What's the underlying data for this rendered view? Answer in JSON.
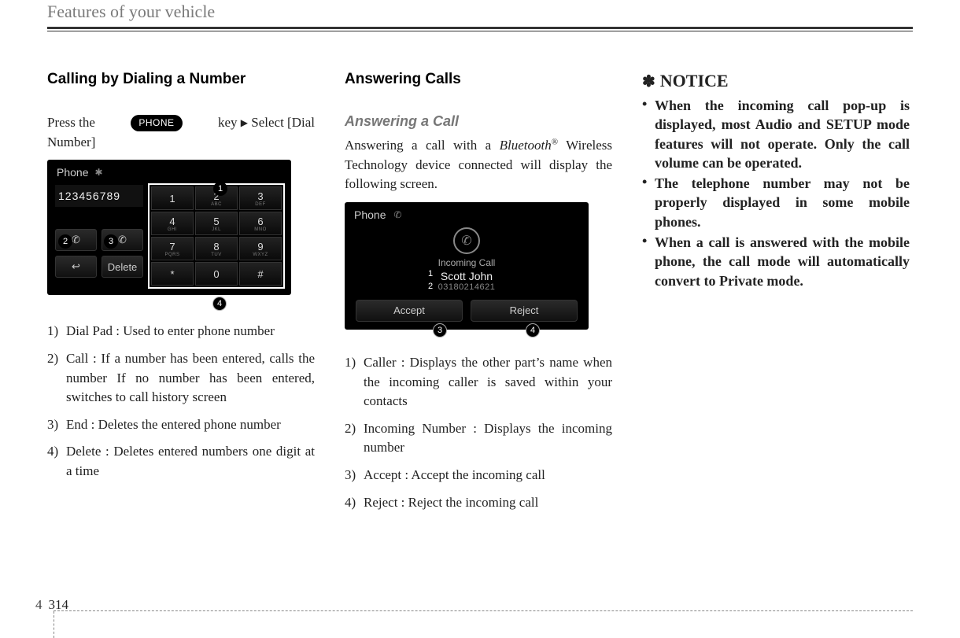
{
  "header": {
    "title": "Features of your vehicle"
  },
  "col1": {
    "heading": "Calling by Dialing a Number",
    "press_a": "Press the",
    "press_b": "key",
    "press_c": "Select [Dial",
    "press_d": "Number]",
    "phone_key_label": "PHONE",
    "shot": {
      "title": "Phone",
      "number": "123456789",
      "delete": "Delete",
      "keys": [
        "1",
        "2",
        "3",
        "4",
        "5",
        "6",
        "7",
        "8",
        "9",
        "*",
        "0",
        "#"
      ],
      "subs": [
        "",
        "ABC",
        "DEF",
        "GHI",
        "JKL",
        "MNO",
        "PQRS",
        "TUV",
        "WXYZ",
        "",
        "",
        ""
      ]
    },
    "markers": [
      "1",
      "2",
      "3",
      "4"
    ],
    "list": [
      "Dial Pad : Used to enter phone number",
      "Call : If a number has been entered, calls the number If no number has been entered, switches to call history screen",
      "End : Deletes the entered phone number",
      "Delete : Deletes entered numbers one digit at a time"
    ]
  },
  "col2": {
    "heading": "Answering Calls",
    "subheading": "Answering a Call",
    "body_a": "Answering a call with a ",
    "body_b": "Bluetooth",
    "body_sup": "®",
    "body_c": " Wireless Technology device connected will display the following screen.",
    "shot": {
      "title": "Phone",
      "label": "Incoming Call",
      "name": "Scott John",
      "number": "03180214621",
      "accept": "Accept",
      "reject": "Reject"
    },
    "markers": [
      "1",
      "2",
      "3",
      "4"
    ],
    "list": [
      "Caller : Displays the other part’s name when the incoming caller is saved within your contacts",
      "Incoming Number : Displays the incoming number",
      "Accept : Accept the incoming call",
      "Reject : Reject the incoming call"
    ]
  },
  "col3": {
    "notice_label": "NOTICE",
    "items": [
      "When the incoming call pop-up is displayed, most Audio and SETUP mode features will not operate. Only the call volume can be operated.",
      "The telephone number may not be properly displayed in some mobile phones.",
      "When a call is answered with the mobile phone, the call mode will automatically convert to Private mode."
    ]
  },
  "footer": {
    "section": "4",
    "page": "314"
  }
}
